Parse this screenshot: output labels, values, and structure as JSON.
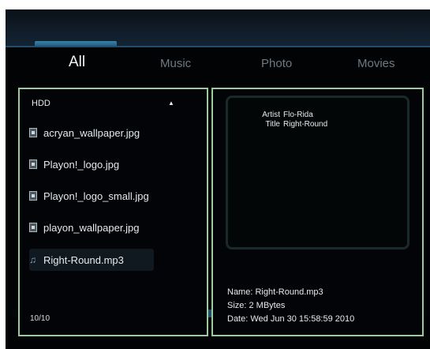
{
  "tabs": [
    {
      "label": "All",
      "active": true
    },
    {
      "label": "Music",
      "active": false
    },
    {
      "label": "Photo",
      "active": false
    },
    {
      "label": "Movies",
      "active": false
    }
  ],
  "browser": {
    "drive": "HDD",
    "scroll_up_glyph": "▲",
    "items": [
      {
        "name": "acryan_wallpaper.jpg",
        "type": "image",
        "icon": "image-file-icon"
      },
      {
        "name": "Playon!_logo.jpg",
        "type": "image",
        "icon": "image-file-icon"
      },
      {
        "name": "Playon!_logo_small.jpg",
        "type": "image",
        "icon": "image-file-icon"
      },
      {
        "name": "playon_wallpaper.jpg",
        "type": "image",
        "icon": "image-file-icon"
      },
      {
        "name": "Right-Round.mp3",
        "type": "audio",
        "icon": "music-note-icon",
        "selected": true
      }
    ],
    "counter": "10/10"
  },
  "details": {
    "artist_label": "Artist",
    "artist_value": "Flo-Rida",
    "title_label": "Title",
    "title_value": "Right-Round",
    "name": "Name: Right-Round.mp3",
    "size": "Size: 2 MBytes",
    "date": "Date: Wed Jun 30 15:58:59 2010"
  },
  "colors": {
    "background": "#010304",
    "panel_border": "#9cc9a0",
    "accent": "#3a82a8",
    "text": "#e6eaee",
    "inactive_tab": "#6c7a86"
  }
}
